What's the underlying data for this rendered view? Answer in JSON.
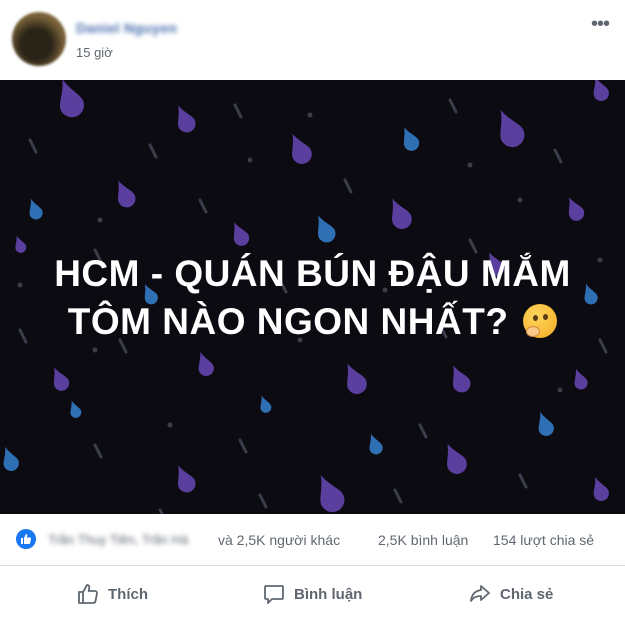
{
  "post": {
    "author": "Daniel Nguyen",
    "time": "15 giờ",
    "more_glyph": "•••",
    "headline_line1": "HCM - QUÁN BÚN ĐẬU MẮM",
    "headline_line2": "TÔM NÀO NGON NHẤT?",
    "headline_emoji": "thinking-face-emoji"
  },
  "stats": {
    "reaction_icon": "like-icon",
    "reactor_names": "Trần Thuy Tiên, Trần Hà",
    "others_text": "và 2,5K người khác",
    "comments_text": "2,5K bình luận",
    "shares_text": "154 lượt chia sẻ"
  },
  "actions": {
    "like_label": "Thích",
    "comment_label": "Bình luận",
    "share_label": "Chia sẻ"
  },
  "colors": {
    "background_dark": "#0c0b12",
    "drop_purple": "#5b3f9e",
    "drop_blue": "#2f6fb4",
    "drop_grey": "#3a3e4a",
    "link_blue": "#1877f2",
    "muted_text": "#606770"
  }
}
